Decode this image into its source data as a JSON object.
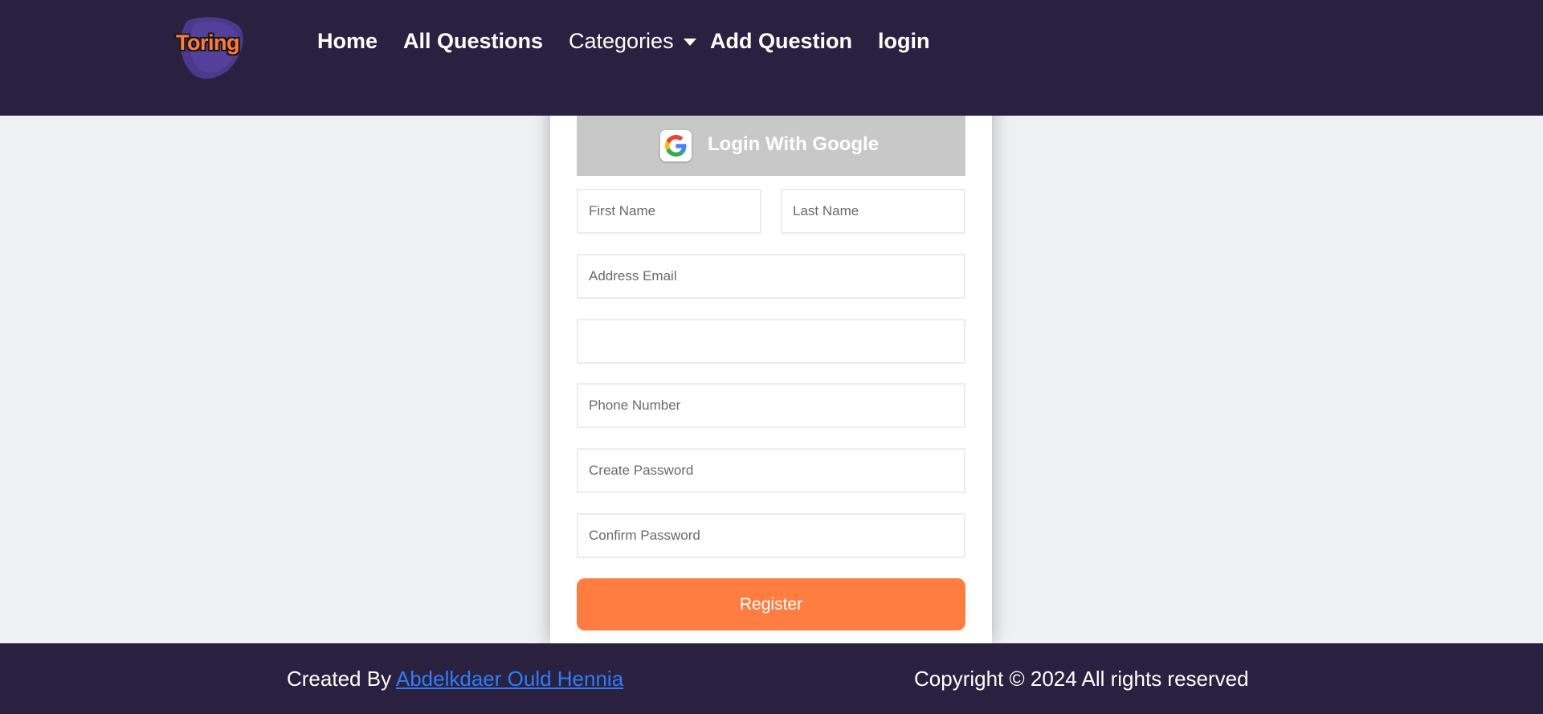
{
  "brand": {
    "logo_text": "Toring"
  },
  "nav": {
    "home": "Home",
    "all_questions": "All Questions",
    "categories": "Categories",
    "add_question": "Add Question",
    "login": "login"
  },
  "form": {
    "google_button": "Login With Google",
    "first_name_placeholder": "First Name",
    "last_name_placeholder": "Last Name",
    "email_placeholder": "Address Email",
    "blank_field_value": "",
    "phone_placeholder": "Phone Number",
    "create_password_placeholder": "Create Password",
    "confirm_password_placeholder": "Confirm Password",
    "register_button": "Register"
  },
  "footer": {
    "created_by": "Created By",
    "author": "Abdelkdaer Ould Hennia",
    "copyright": "Copyright © 2024 All rights reserved"
  },
  "colors": {
    "nav_bg": "#2a2141",
    "page_bg": "#f0f1f5",
    "accent": "#ff7d40",
    "google_button_bg": "#c8c8c8",
    "link": "#2f7cf6"
  },
  "icons": {
    "brand": "logo-icon",
    "dropdown": "caret-down-icon",
    "google": "google-icon"
  }
}
